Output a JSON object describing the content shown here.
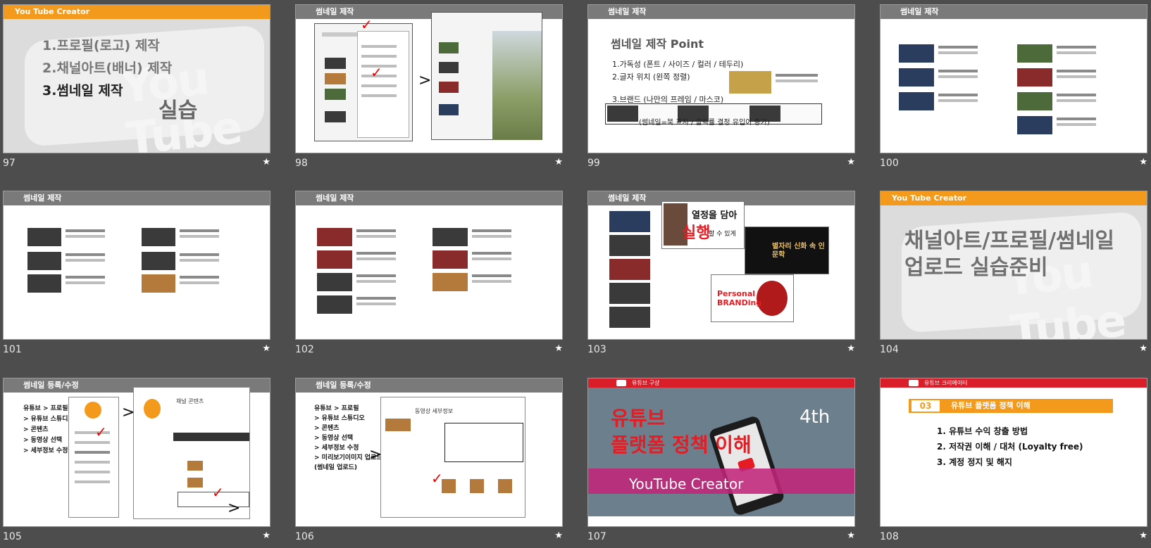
{
  "slides": [
    {
      "num": "97",
      "header": "You Tube Creator",
      "items": [
        "1.프로필(로고) 제작",
        "2.채널아트(배너) 제작",
        "3.썸네일 제작"
      ],
      "practice": "실습"
    },
    {
      "num": "98",
      "header": "썸네일 제작"
    },
    {
      "num": "99",
      "header": "썸네일 제작",
      "title": "썸네일 제작  Point",
      "points": [
        "1.가독성 (폰트 / 사이즈 / 컬러 / 테두리)",
        "2.글자 위치 (왼쪽 정렬)",
        "3.브랜드 (나만의 프레임 / 마스코)"
      ],
      "note": "(썸네일=북 표지 / 클릭률 결정 유입이 증가)"
    },
    {
      "num": "100",
      "header": "썸네일 제작"
    },
    {
      "num": "101",
      "header": "썸네일 제작"
    },
    {
      "num": "102",
      "header": "썸네일 제작"
    },
    {
      "num": "103",
      "header": "썸네일 제작",
      "passion": "열정을 담아",
      "action": "실행",
      "can": "할 수 있게",
      "brand": "Personal BRANDing",
      "myth": "별자리 신화 속 인문학"
    },
    {
      "num": "104",
      "header": "You Tube Creator",
      "title1": "채널아트/프로필/썸네일",
      "title2": "업로드 실습준비"
    },
    {
      "num": "105",
      "header": "썸네일 등록/수정",
      "steps": [
        "유튜브 > 프로필",
        "> 유튜브 스튜디오",
        "> 콘텐츠",
        "> 동영상 선택",
        "> 세부정보 수정"
      ],
      "panel_title": "채널 콘텐츠"
    },
    {
      "num": "106",
      "header": "썸네일 등록/수정",
      "steps": [
        "유튜브 > 프로필",
        "> 유튜브 스튜디오",
        "> 콘텐츠",
        "> 동영상 선택",
        "> 세부정보 수정",
        "> 미리보기이미지 업로드",
        "(썸네일 업로드)"
      ],
      "panel_title": "동영상 세부정보"
    },
    {
      "num": "107",
      "header": "유튜브 구상",
      "title1": "유튜브",
      "title2": "플랫폼 정책 이해",
      "badge": "4th",
      "creator": "YouTube Creator"
    },
    {
      "num": "108",
      "header": "유튜브 크리에이터",
      "section_num": "03",
      "section_title": "유튜브 플랫폼 정책 이해",
      "items": [
        "1. 유튜브 수익 창출 방법",
        "2. 저작권 이해 / 대처 (Loyalty free)",
        "3. 계정 정지 및 해지"
      ]
    }
  ],
  "star": "★",
  "colors": {
    "orange": "#f39a1c",
    "red": "#e51c23",
    "gray_header": "#7a7a7a",
    "background": "#4d4d4d"
  }
}
